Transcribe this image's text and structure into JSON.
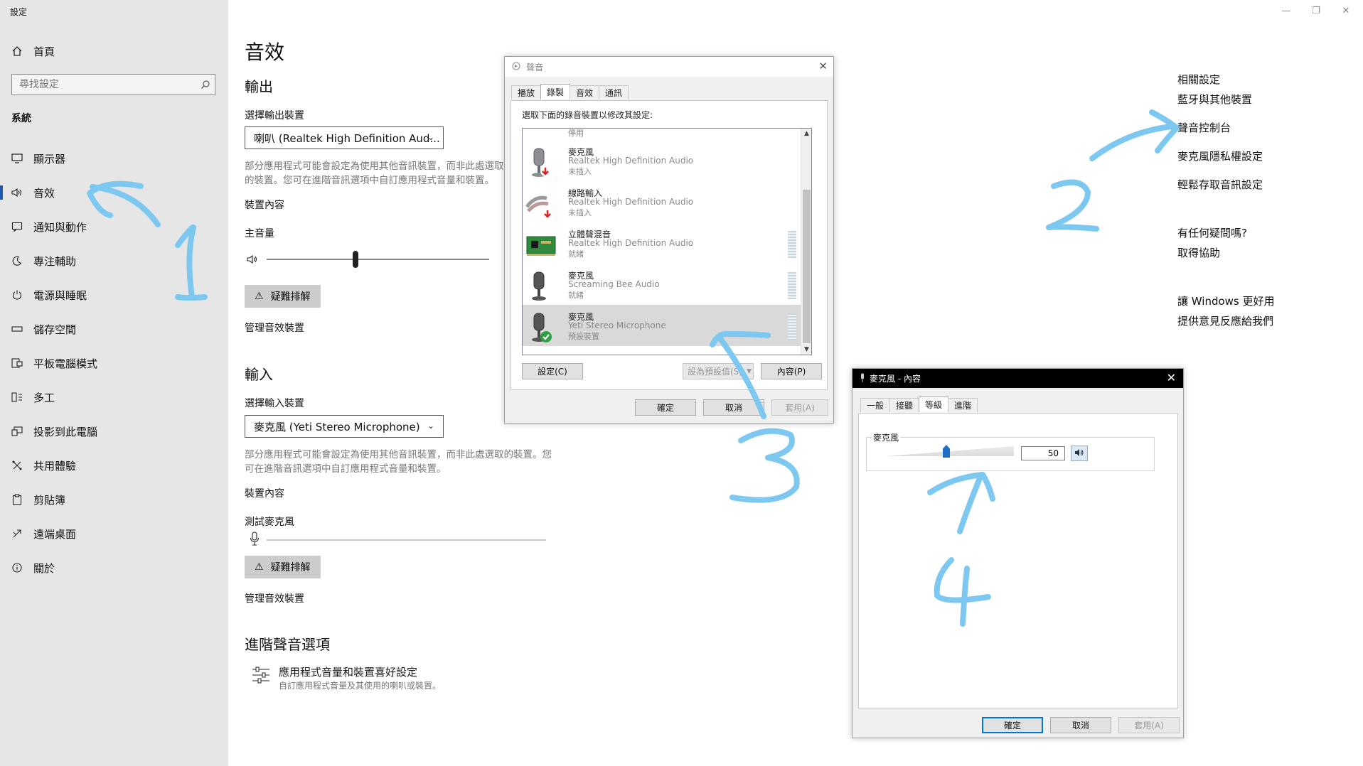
{
  "app": {
    "title": "設定"
  },
  "window_controls": {
    "minimize": "—",
    "restore": "❐",
    "close": "✕"
  },
  "nav": {
    "home": {
      "icon": "home-icon",
      "label": "首頁"
    },
    "search_placeholder": "尋找設定",
    "section_heading": "系統",
    "items": [
      {
        "icon": "display-icon",
        "label": "顯示器"
      },
      {
        "icon": "speaker-icon",
        "label": "音效"
      },
      {
        "icon": "notification-icon",
        "label": "通知與動作"
      },
      {
        "icon": "moon-icon",
        "label": "專注輔助"
      },
      {
        "icon": "power-icon",
        "label": "電源與睡眠"
      },
      {
        "icon": "storage-icon",
        "label": "儲存空間"
      },
      {
        "icon": "tablet-icon",
        "label": "平板電腦模式"
      },
      {
        "icon": "multitask-icon",
        "label": "多工"
      },
      {
        "icon": "project-icon",
        "label": "投影到此電腦"
      },
      {
        "icon": "shared-icon",
        "label": "共用體驗"
      },
      {
        "icon": "clipboard-icon",
        "label": "剪貼簿"
      },
      {
        "icon": "remote-desktop-icon",
        "label": "遠端桌面"
      },
      {
        "icon": "info-icon",
        "label": "關於"
      }
    ]
  },
  "main": {
    "page_title": "音效",
    "output": {
      "heading": "輸出",
      "select_label": "選擇輸出裝置",
      "selected": "喇叭 (Realtek High Definition Aud...",
      "note": "部分應用程式可能會設定為使用其他音訊裝置，而非此處選取的裝置。您可在進階音訊選項中自訂應用程式音量和裝置。",
      "device_props": "裝置內容",
      "master_volume_label": "主音量",
      "master_volume": 40,
      "troubleshoot": "疑難排解",
      "manage": "管理音效裝置"
    },
    "input": {
      "heading": "輸入",
      "select_label": "選擇輸入裝置",
      "selected": "麥克風 (Yeti Stereo Microphone)",
      "note": "部分應用程式可能會設定為使用其他音訊裝置，而非此處選取的裝置。您可在進階音訊選項中自訂應用程式音量和裝置。",
      "device_props": "裝置內容",
      "test_label": "測試麥克風",
      "troubleshoot": "疑難排解",
      "manage": "管理音效裝置"
    },
    "advanced": {
      "heading": "進階聲音選項",
      "item_title": "應用程式音量和裝置喜好設定",
      "item_desc": "自訂應用程式音量及其使用的喇叭或裝置。"
    }
  },
  "related": {
    "heading": "相關設定",
    "links": [
      "藍牙與其他裝置",
      "聲音控制台",
      "麥克風隱私權設定",
      "輕鬆存取音訊設定"
    ],
    "help_heading": "有任何疑問嗎?",
    "help_link": "取得協助",
    "improve_heading": "讓 Windows 更好用",
    "improve_link": "提供意見反應給我們"
  },
  "sound_dialog": {
    "title": "聲音",
    "tabs": [
      "播放",
      "錄製",
      "音效",
      "通訊"
    ],
    "active_tab": 1,
    "instruction": "選取下面的錄音裝置以修改其設定:",
    "partial_status": "停用",
    "devices": [
      {
        "icon": "microphone-icon",
        "name": "麥克風",
        "driver": "Realtek High Definition Audio",
        "status": "未插入",
        "badge": "down",
        "meter": false,
        "selected": false
      },
      {
        "icon": "line-in-icon",
        "name": "線路輸入",
        "driver": "Realtek High Definition Audio",
        "status": "未插入",
        "badge": "down",
        "meter": false,
        "selected": false
      },
      {
        "icon": "sound-card-icon",
        "name": "立體聲混音",
        "driver": "Realtek High Definition Audio",
        "status": "就緒",
        "badge": "",
        "meter": true,
        "selected": false
      },
      {
        "icon": "microphone-icon",
        "name": "麥克風",
        "driver": "Screaming Bee Audio",
        "status": "就緒",
        "badge": "",
        "meter": true,
        "selected": false
      },
      {
        "icon": "microphone-icon",
        "name": "麥克風",
        "driver": "Yeti Stereo Microphone",
        "status": "預設裝置",
        "badge": "check",
        "meter": true,
        "selected": true
      }
    ],
    "configure": "設定(C)",
    "set_default": "設為預設值(S)",
    "properties": "內容(P)",
    "ok": "確定",
    "cancel": "取消",
    "apply": "套用(A)"
  },
  "mic_dialog": {
    "title": "麥克風 - 內容",
    "tabs": [
      "一般",
      "接聽",
      "等級",
      "進階"
    ],
    "active_tab": 2,
    "group_label": "麥克風",
    "level": 50,
    "level_display": "50",
    "ok": "確定",
    "cancel": "取消",
    "apply": "套用(A)"
  },
  "annotations": [
    "1",
    "2",
    "3",
    "4"
  ],
  "colors": {
    "annotation": "#7cc8f0",
    "nav_bg": "#e6e6e6",
    "accent": "#0078d7"
  }
}
